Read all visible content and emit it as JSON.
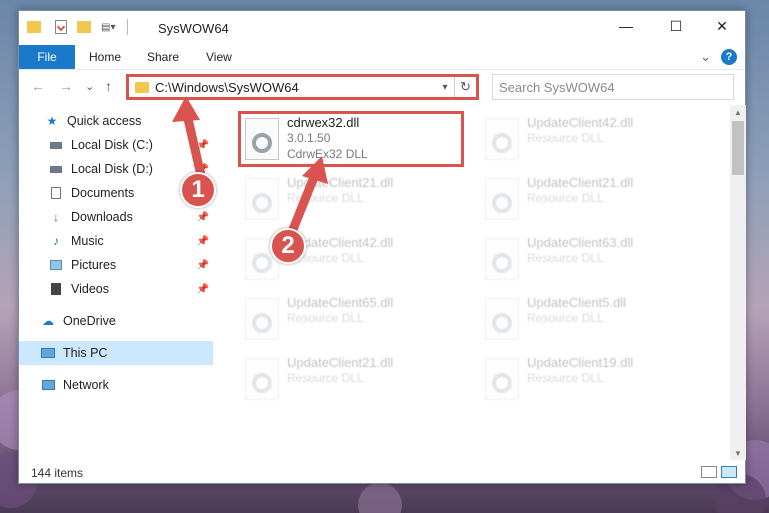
{
  "window": {
    "title": "SysWOW64",
    "minimize_glyph": "—",
    "maximize_glyph": "☐",
    "close_glyph": "✕"
  },
  "ribbon": {
    "tabs": [
      {
        "label": "File"
      },
      {
        "label": "Home"
      },
      {
        "label": "Share"
      },
      {
        "label": "View"
      }
    ],
    "expand_glyph": "⌄",
    "help_glyph": "?"
  },
  "nav": {
    "back_glyph": "←",
    "forward_glyph": "→",
    "recent_glyph": "⌄",
    "up_glyph": "↑",
    "address": "C:\\Windows\\SysWOW64",
    "search_placeholder": "Search SysWOW64"
  },
  "sidebar": {
    "items": [
      {
        "label": "Quick access",
        "icon": "star-icon"
      },
      {
        "label": "Local Disk (C:)",
        "icon": "drive-icon",
        "pinned": true
      },
      {
        "label": "Local Disk (D:)",
        "icon": "drive-icon",
        "pinned": true
      },
      {
        "label": "Documents",
        "icon": "documents-icon",
        "pinned": true
      },
      {
        "label": "Downloads",
        "icon": "download-icon",
        "pinned": true
      },
      {
        "label": "Music",
        "icon": "music-icon",
        "pinned": true
      },
      {
        "label": "Pictures",
        "icon": "pictures-icon",
        "pinned": true
      },
      {
        "label": "Videos",
        "icon": "videos-icon",
        "pinned": true
      },
      {
        "label": "OneDrive",
        "icon": "cloud-icon"
      },
      {
        "label": "This PC",
        "icon": "computer-icon",
        "selected": true
      },
      {
        "label": "Network",
        "icon": "network-icon"
      }
    ]
  },
  "files": [
    {
      "name": "cdrwex32.dll",
      "line1": "3.0.1.50",
      "line2": "CdrwEx32 DLL",
      "highlighted": true
    },
    {
      "name": "UpdateClient42.dll",
      "line1": "Resource DLL"
    },
    {
      "name": "UpdateClient21.dll",
      "line1": "Resource DLL"
    },
    {
      "name": "UpdateClient21.dll",
      "line1": "Resource DLL"
    },
    {
      "name": "UpdateClient42.dll",
      "line1": "Resource DLL"
    },
    {
      "name": "UpdateClient63.dll",
      "line1": "Resource DLL"
    },
    {
      "name": "UpdateClient65.dll",
      "line1": "Resource DLL"
    },
    {
      "name": "UpdateClient5.dll",
      "line1": "Resource DLL"
    },
    {
      "name": "UpdateClient21.dll",
      "line1": "Resource DLL"
    },
    {
      "name": "UpdateClient19.dll",
      "line1": "Resource DLL"
    }
  ],
  "status": {
    "item_count": "144 items"
  },
  "annotations": [
    {
      "number": "1"
    },
    {
      "number": "2"
    }
  ],
  "colors": {
    "accent": "#1979ca",
    "annotation_red": "#d9534f",
    "selection": "#cce8ff"
  }
}
